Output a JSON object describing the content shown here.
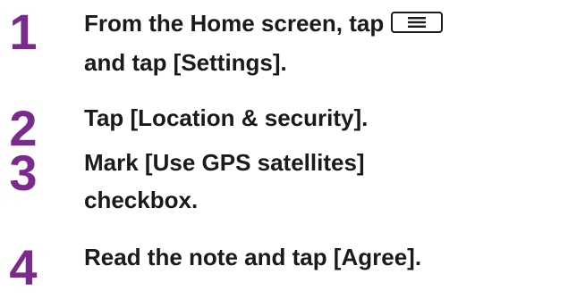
{
  "steps": [
    {
      "number": "1",
      "line1": "From the Home screen, tap",
      "line1_icon": "menu-key-icon",
      "line2": "and tap [Settings]."
    },
    {
      "number": "2",
      "line1": "Tap [Location & security]."
    },
    {
      "number": "3",
      "line1": "Mark [Use GPS satellites]",
      "line2": "checkbox."
    },
    {
      "number": "4",
      "line1": "Read the note and tap [Agree]."
    }
  ],
  "colors": {
    "step_number": "#7a2a8c",
    "text": "#1a1a1a",
    "background": "#ffffff"
  }
}
